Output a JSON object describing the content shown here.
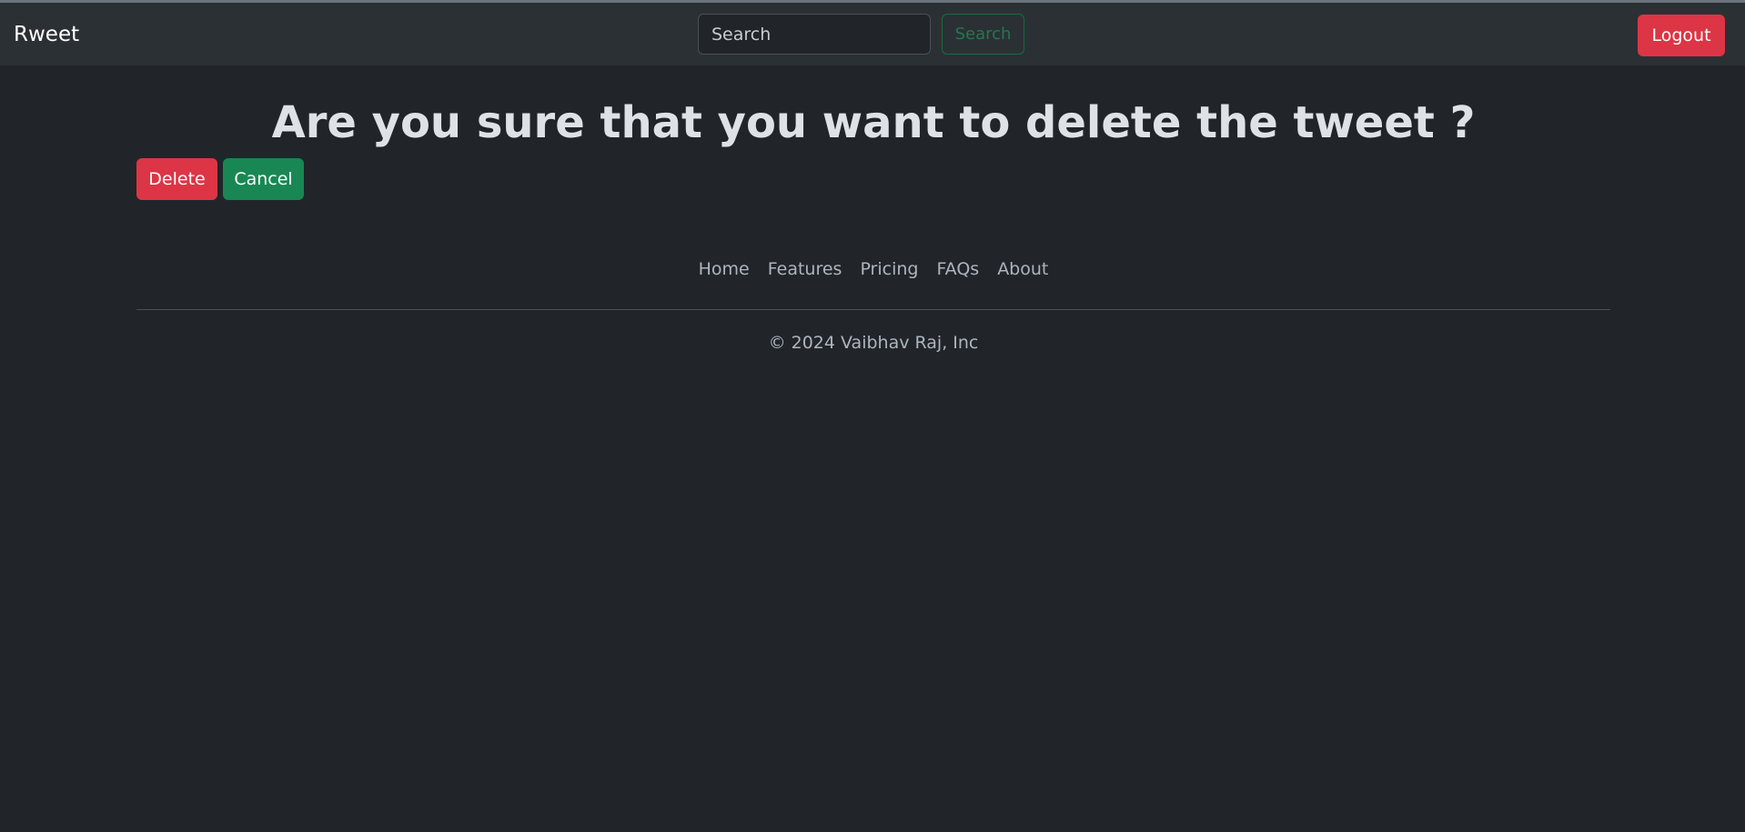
{
  "navbar": {
    "brand": "Rweet",
    "search_placeholder": "Search",
    "search_button_label": "Search",
    "logout_label": "Logout"
  },
  "main": {
    "title": "Are you sure that you want to delete the tweet ?",
    "delete_label": "Delete",
    "cancel_label": "Cancel"
  },
  "footer": {
    "links": [
      "Home",
      "Features",
      "Pricing",
      "FAQs",
      "About"
    ],
    "copyright": "© 2024 Vaibhav Raj, Inc"
  },
  "colors": {
    "background": "#212529",
    "navbar": "#2b3035",
    "danger": "#dc3545",
    "success": "#198754"
  }
}
